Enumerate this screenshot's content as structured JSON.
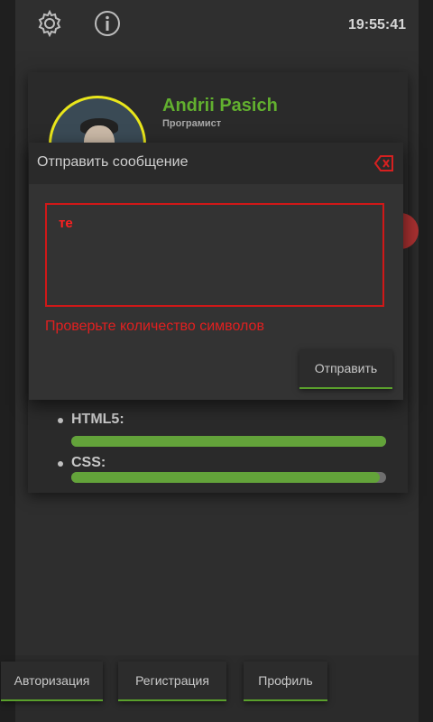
{
  "status": {
    "clock": "19:55:41"
  },
  "profile": {
    "name": "Andrii Pasich",
    "title": "Програмист"
  },
  "skills": [
    {
      "label": "HTML5:",
      "level": 1.0
    },
    {
      "label": "CSS:",
      "level": 0.98
    }
  ],
  "modal": {
    "title": "Отправить сообщение",
    "message_value": "те",
    "error_text": "Проверьте количество символов",
    "send_label": "Отправить"
  },
  "bottom_nav": {
    "items": [
      "Авторизация",
      "Регистрация",
      "Профиль"
    ]
  },
  "colors": {
    "accent_green": "#62b02f",
    "error_red": "#e02020",
    "avatar_ring": "#e9e61b"
  },
  "icons": {
    "settings": "gear-icon",
    "info": "info-icon",
    "close": "close-icon"
  }
}
